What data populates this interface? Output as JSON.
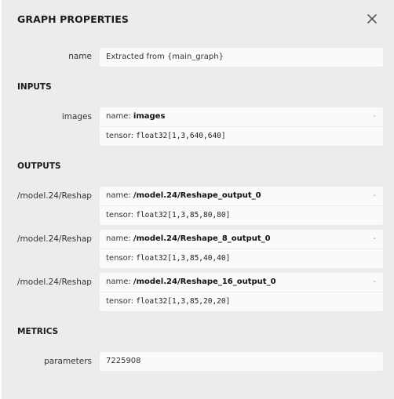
{
  "panel": {
    "title": "GRAPH PROPERTIES",
    "close_icon": "close-icon"
  },
  "graph": {
    "name_label": "name",
    "name_value": "Extracted from {main_graph}"
  },
  "inputs": {
    "title": "INPUTS",
    "items": [
      {
        "label": "images",
        "name_prefix": "name: ",
        "name": "images",
        "tensor_prefix": "tensor: ",
        "tensor": "float32[1,3,640,640]",
        "expander": "-"
      }
    ]
  },
  "outputs": {
    "title": "OUTPUTS",
    "items": [
      {
        "label": "/model.24/Reshape_output_0",
        "name_prefix": "name: ",
        "name": "/model.24/Reshape_output_0",
        "tensor_prefix": "tensor: ",
        "tensor": "float32[1,3,85,80,80]",
        "expander": "-"
      },
      {
        "label": "/model.24/Reshape_8_output_0",
        "name_prefix": "name: ",
        "name": "/model.24/Reshape_8_output_0",
        "tensor_prefix": "tensor: ",
        "tensor": "float32[1,3,85,40,40]",
        "expander": "-"
      },
      {
        "label": "/model.24/Reshape_16_output_0",
        "name_prefix": "name: ",
        "name": "/model.24/Reshape_16_output_0",
        "tensor_prefix": "tensor: ",
        "tensor": "float32[1,3,85,20,20]",
        "expander": "-"
      }
    ]
  },
  "metrics": {
    "title": "METRICS",
    "parameters_label": "parameters",
    "parameters_value": "7225908"
  }
}
